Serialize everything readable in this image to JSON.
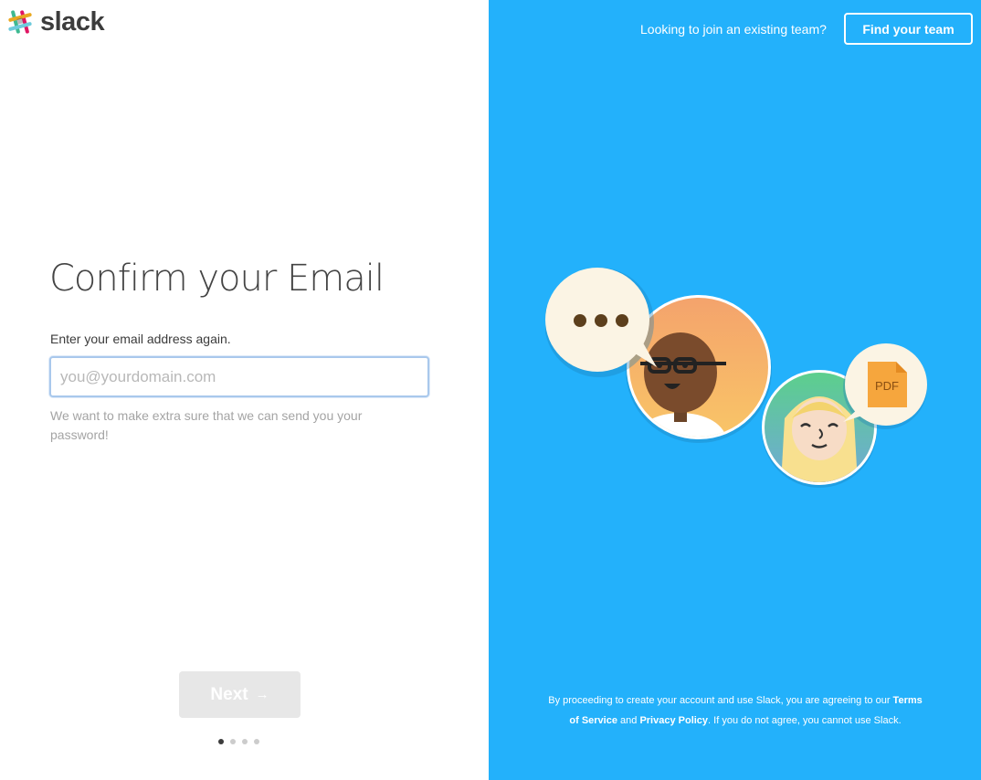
{
  "brand": {
    "wordmark": "slack",
    "colors": {
      "panel_blue": "#23b1fb",
      "input_border": "#a9c8ec",
      "button_disabled": "#e7e7e7"
    }
  },
  "form": {
    "title": "Confirm your Email",
    "label": "Enter your email address again.",
    "email_placeholder": "you@yourdomain.com",
    "email_value": "",
    "hint": "We want to make extra sure that we can send you your password!",
    "next_label": "Next",
    "next_icon": "arrow-right-icon",
    "next_enabled": false
  },
  "progress": {
    "steps_total": 4,
    "current_step": 1
  },
  "header": {
    "join_text": "Looking to join an existing team?",
    "find_team_label": "Find your team"
  },
  "illustration": {
    "pdf_label": "PDF",
    "icons": [
      "chat-bubble-icon",
      "person-glasses-icon",
      "person-blonde-icon",
      "pdf-file-icon"
    ]
  },
  "legal": {
    "prefix": "By proceeding to create your account and use Slack, you are agreeing to our ",
    "terms": "Terms of Service",
    "and": " and ",
    "privacy": "Privacy Policy",
    "suffix": ". If you do not agree, you cannot use Slack."
  }
}
